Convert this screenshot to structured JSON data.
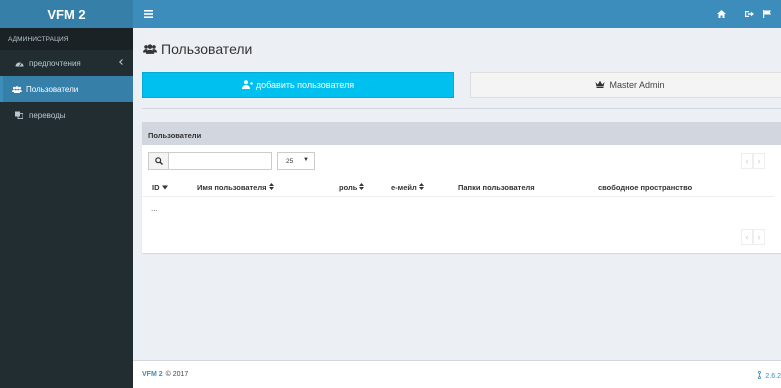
{
  "app": {
    "title": "VFM 2"
  },
  "sidebar": {
    "header": "АДМИНИСТРАЦИЯ",
    "items": [
      {
        "label": "предпочтения",
        "icon": "dashboard-icon",
        "active": false,
        "has_submenu": true
      },
      {
        "label": "Пользователи",
        "icon": "users-icon",
        "active": true
      },
      {
        "label": "переводы",
        "icon": "language-icon",
        "active": false
      }
    ]
  },
  "main": {
    "title": "Пользователи",
    "add_user_label": "добавить пользователя",
    "admin_label": "Master Admin",
    "box_title": "Пользователи",
    "search": {
      "value": "",
      "placeholder": ""
    },
    "per_page": "25",
    "columns": [
      "ID",
      "Имя пользователя",
      "роль",
      "е-мейл",
      "Папки пользователя",
      "свободное пространство"
    ],
    "empty_text": "..."
  },
  "footer": {
    "brand": "VFM 2",
    "copyright": "© 2017",
    "version": "2.6.2"
  },
  "colors": {
    "header": "#3c8dbc",
    "logo": "#367fa9",
    "sidebar": "#222d32",
    "accent": "#00c0ef"
  }
}
